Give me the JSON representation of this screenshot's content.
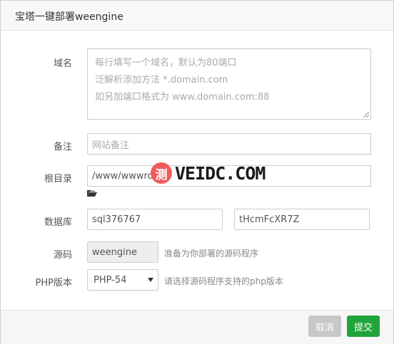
{
  "dialog": {
    "title": "宝塔一键部署weengine"
  },
  "form": {
    "domain": {
      "label": "域名",
      "placeholder_lines": [
        "每行填写一个域名，默认为80端口",
        "泛解析添加方法 *.domain.com",
        "如另加端口格式为 www.domain.com:88"
      ]
    },
    "remark": {
      "label": "备注",
      "placeholder": "网站备注"
    },
    "root": {
      "label": "根目录",
      "value": "/www/wwwroo"
    },
    "database": {
      "label": "数据库",
      "user": "sql376767",
      "password": "tHcmFcXR7Z"
    },
    "source": {
      "label": "源码",
      "value": "weengine",
      "hint": "准备为你部署的源码程序"
    },
    "php": {
      "label": "PHP版本",
      "selected": "PHP-54",
      "hint": "请选择源码程序支持的php版本"
    }
  },
  "footer": {
    "cancel_label": "取消",
    "submit_label": "提交"
  },
  "watermark": {
    "badge": "测",
    "text": "VEIDC.COM"
  },
  "colors": {
    "submit": "#20a53a",
    "cancel": "#c8c8c8",
    "watermark_badge": "#ef5b5b"
  }
}
